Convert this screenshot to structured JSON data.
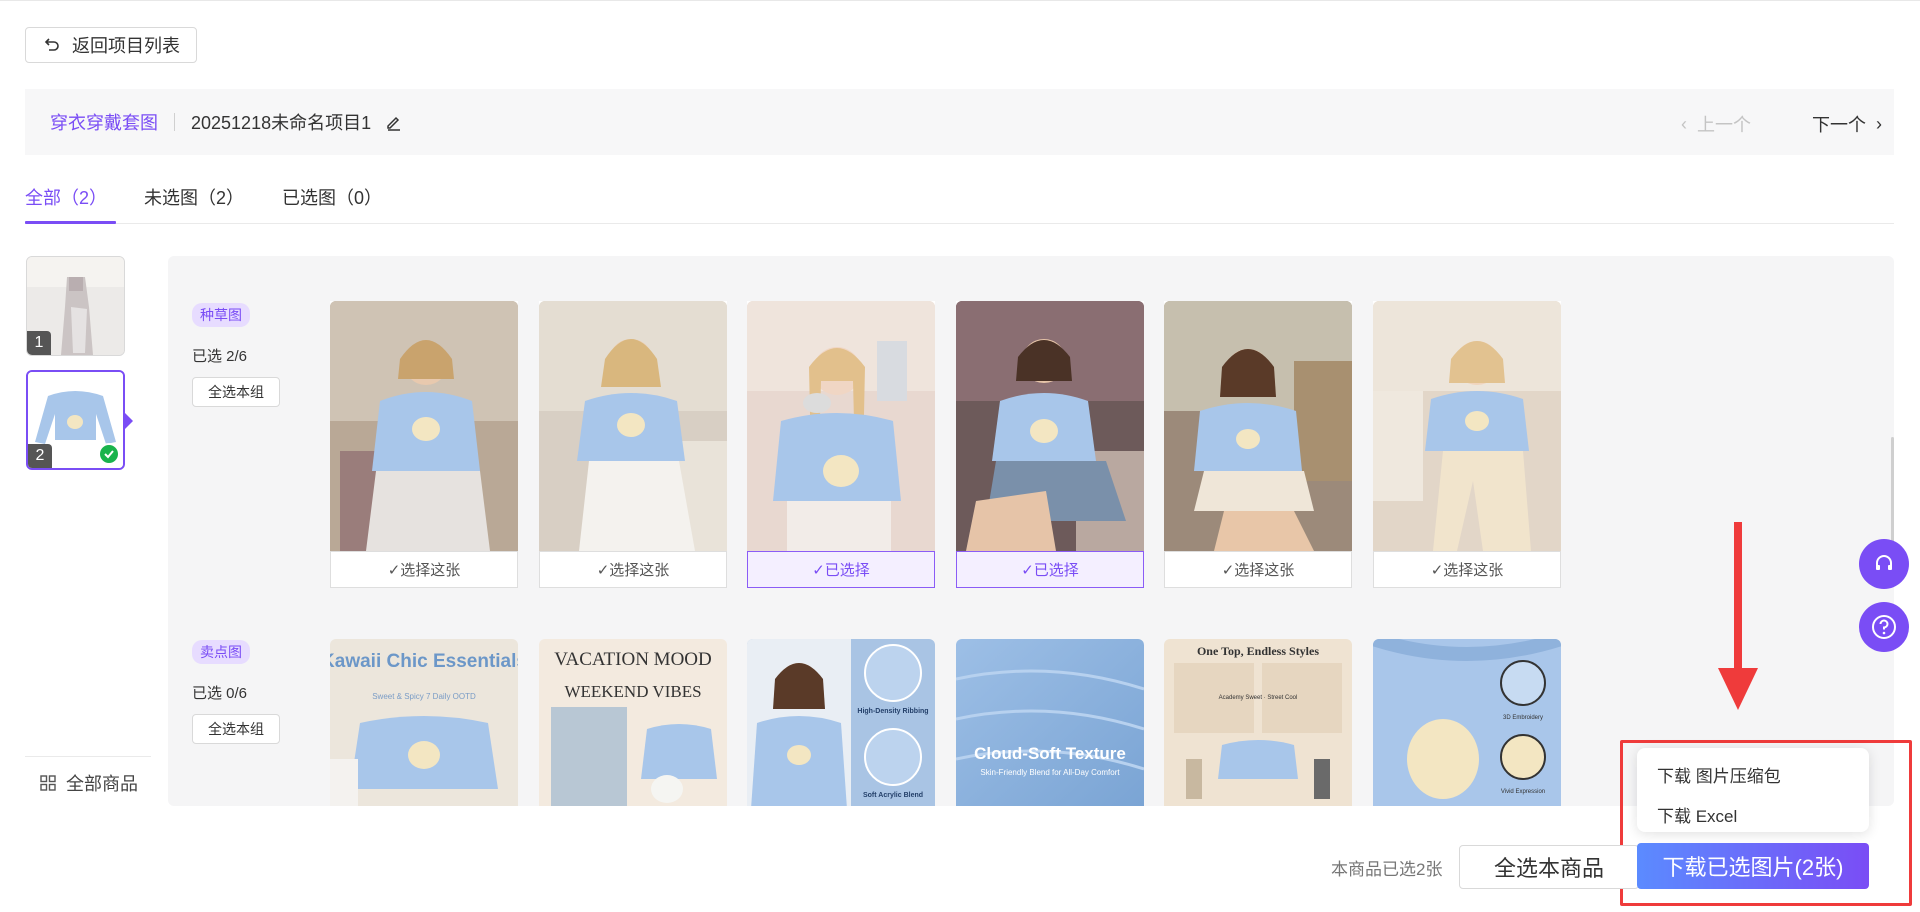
{
  "header": {
    "back_label": "返回项目列表"
  },
  "project": {
    "type": "穿衣穿戴套图",
    "name": "20251218未命名项目1",
    "prev_label": "上一个",
    "next_label": "下一个"
  },
  "tabs": [
    {
      "label": "全部（2）",
      "active": true
    },
    {
      "label": "未选图（2）",
      "active": false
    },
    {
      "label": "已选图（0）",
      "active": false
    }
  ],
  "products": [
    {
      "num": "1",
      "selected": false
    },
    {
      "num": "2",
      "selected": true
    }
  ],
  "sidebar": {
    "all_products_label": "全部商品"
  },
  "groups": [
    {
      "label": "种草图",
      "count": "已选 2/6",
      "select_all": "全选本组",
      "cards": [
        {
          "pick": "✓选择这张",
          "on": false
        },
        {
          "pick": "✓选择这张",
          "on": false
        },
        {
          "pick": "✓已选择",
          "on": true
        },
        {
          "pick": "✓已选择",
          "on": true
        },
        {
          "pick": "✓选择这张",
          "on": false
        },
        {
          "pick": "✓选择这张",
          "on": false
        }
      ]
    },
    {
      "label": "卖点图",
      "count": "已选 0/6",
      "select_all": "全选本组",
      "cards": [
        {
          "title": "Kawaii Chic Essentials",
          "subtitle": "Sweet & Spicy 7 Daily OOTD"
        },
        {
          "title": "VACATION MOOD",
          "subtitle": "WEEKEND VIBES"
        },
        {
          "title": "High-Density Ribbing",
          "subtitle": "Soft Acrylic Blend"
        },
        {
          "title": "Cloud-Soft Texture",
          "subtitle": "Skin-Friendly Blend for All-Day Comfort"
        },
        {
          "title": "One Top, Endless Styles",
          "subtitle": "Academy Sweet · Street Cool"
        },
        {
          "title": "3D Embroidery",
          "subtitle": "Vivid Expression"
        }
      ]
    }
  ],
  "menu": {
    "item1": "下载 图片压缩包",
    "item2": "下载 Excel"
  },
  "footer": {
    "info": "本商品已选2张",
    "select_all_product": "全选本商品",
    "download": "下载已选图片(2张)"
  }
}
